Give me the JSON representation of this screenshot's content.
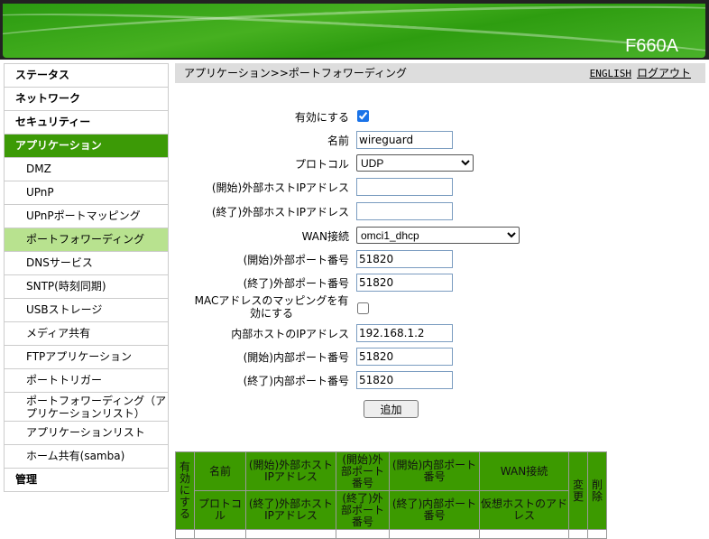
{
  "header": {
    "model": "F660A"
  },
  "sidebar": {
    "items": [
      {
        "label": "ステータス",
        "type": "top"
      },
      {
        "label": "ネットワーク",
        "type": "top"
      },
      {
        "label": "セキュリティー",
        "type": "top"
      },
      {
        "label": "アプリケーション",
        "type": "active"
      },
      {
        "label": "DMZ",
        "type": "sub"
      },
      {
        "label": "UPnP",
        "type": "sub"
      },
      {
        "label": "UPnPポートマッピング",
        "type": "sub"
      },
      {
        "label": "ポートフォワーディング",
        "type": "selected"
      },
      {
        "label": "DNSサービス",
        "type": "sub"
      },
      {
        "label": "SNTP(時刻同期)",
        "type": "sub"
      },
      {
        "label": "USBストレージ",
        "type": "sub"
      },
      {
        "label": "メディア共有",
        "type": "sub"
      },
      {
        "label": "FTPアプリケーション",
        "type": "sub"
      },
      {
        "label": "ポートトリガー",
        "type": "sub"
      },
      {
        "label": "ポートフォワーディング（アプリケーションリスト）",
        "type": "two"
      },
      {
        "label": "アプリケーションリスト",
        "type": "sub"
      },
      {
        "label": "ホーム共有(samba)",
        "type": "sub"
      },
      {
        "label": "管理",
        "type": "top"
      }
    ]
  },
  "breadcrumb": "アプリケーション>>ポートフォワーディング",
  "links": {
    "english": "ENGLISH",
    "logout": "ログアウト"
  },
  "form": {
    "enable": {
      "label": "有効にする",
      "checked": true
    },
    "name": {
      "label": "名前",
      "value": "wireguard"
    },
    "protocol": {
      "label": "プロトコル",
      "value": "UDP"
    },
    "ext_host_start": {
      "label": "(開始)外部ホストIPアドレス",
      "value": ""
    },
    "ext_host_end": {
      "label": "(終了)外部ホストIPアドレス",
      "value": ""
    },
    "wan": {
      "label": "WAN接続",
      "value": "omci1_dhcp"
    },
    "ext_port_start": {
      "label": "(開始)外部ポート番号",
      "value": "51820"
    },
    "ext_port_end": {
      "label": "(終了)外部ポート番号",
      "value": "51820"
    },
    "mac_map": {
      "label": "MACアドレスのマッピングを有効にする",
      "checked": false
    },
    "int_host": {
      "label": "内部ホストのIPアドレス",
      "value": "192.168.1.2"
    },
    "int_port_start": {
      "label": "(開始)内部ポート番号",
      "value": "51820"
    },
    "int_port_end": {
      "label": "(終了)内部ポート番号",
      "value": "51820"
    },
    "add_button": "追加"
  },
  "table": {
    "enable": "有効にする",
    "name": "名前",
    "protocol": "プロトコル",
    "ext_host_start": "(開始)外部ホストIPアドレス",
    "ext_host_end": "(終了)外部ホストIPアドレス",
    "ext_port_start": "(開始)外部ポート番号",
    "ext_port_end": "(終了)外部ポート番号",
    "int_port_start": "(開始)内部ポート番号",
    "int_port_end": "(終了)内部ポート番号",
    "wan": "WAN接続",
    "virtual_host": "仮想ホストのアドレス",
    "modify": "変更",
    "delete": "削除"
  }
}
